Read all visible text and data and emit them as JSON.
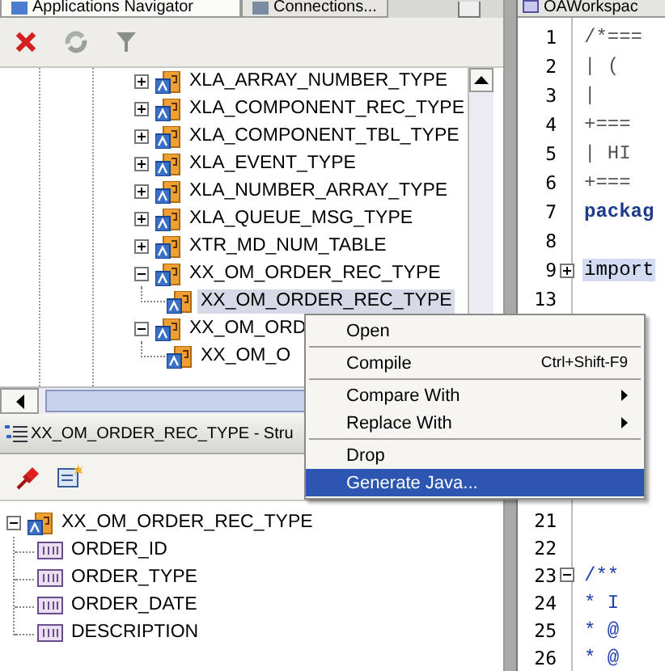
{
  "navigator": {
    "tabs": [
      {
        "label": "Applications Navigator",
        "selected": true
      },
      {
        "label": "Connections...",
        "selected": false
      }
    ],
    "tree": [
      {
        "label": "XLA_ARRAY_NUMBER_TYPE",
        "expanded": false,
        "selected": false
      },
      {
        "label": "XLA_COMPONENT_REC_TYPE",
        "expanded": false,
        "selected": false
      },
      {
        "label": "XLA_COMPONENT_TBL_TYPE",
        "expanded": false,
        "selected": false
      },
      {
        "label": "XLA_EVENT_TYPE",
        "expanded": false,
        "selected": false
      },
      {
        "label": "XLA_NUMBER_ARRAY_TYPE",
        "expanded": false,
        "selected": false
      },
      {
        "label": "XLA_QUEUE_MSG_TYPE",
        "expanded": false,
        "selected": false
      },
      {
        "label": "XTR_MD_NUM_TABLE",
        "expanded": false,
        "selected": false
      },
      {
        "label": "XX_OM_ORDER_REC_TYPE",
        "expanded": true,
        "selected": false,
        "children": [
          {
            "label": "XX_OM_ORDER_REC_TYPE",
            "selected": true
          }
        ]
      },
      {
        "label": "XX_OM_ORD",
        "expanded": true,
        "selected": false,
        "children": [
          {
            "label": "XX_OM_O",
            "selected": false
          }
        ]
      }
    ]
  },
  "structure": {
    "title": "XX_OM_ORDER_REC_TYPE - Stru",
    "tree": [
      {
        "label": "XX_OM_ORDER_REC_TYPE",
        "expanded": true,
        "children": [
          {
            "label": "ORDER_ID"
          },
          {
            "label": "ORDER_TYPE"
          },
          {
            "label": "ORDER_DATE"
          },
          {
            "label": "DESCRIPTION"
          }
        ]
      }
    ]
  },
  "editor": {
    "tab": "OAWorkspac",
    "lines_top": [
      {
        "number": "1",
        "code": "/*===",
        "kind": "comment",
        "highlighted": false
      },
      {
        "number": "2",
        "code": "|   (",
        "kind": "comment",
        "highlighted": false
      },
      {
        "number": "3",
        "code": "|",
        "kind": "comment",
        "highlighted": false
      },
      {
        "number": "4",
        "code": "+===",
        "kind": "comment",
        "highlighted": false
      },
      {
        "number": "5",
        "code": "|  HI",
        "kind": "comment",
        "highlighted": false
      },
      {
        "number": "6",
        "code": "+===",
        "kind": "comment",
        "highlighted": false
      },
      {
        "number": "7",
        "code": "packag",
        "kind": "keyword",
        "highlighted": false
      },
      {
        "number": "8",
        "kind": "plain",
        "highlighted": false
      },
      {
        "number": "9",
        "code": "import",
        "kind": "plain",
        "highlighted": true,
        "folded": true
      },
      {
        "number": "13",
        "kind": "plain",
        "highlighted": false
      }
    ],
    "lines_bottom": [
      {
        "number": "21",
        "kind": "plain",
        "highlighted": false
      },
      {
        "number": "22",
        "kind": "plain",
        "highlighted": false
      },
      {
        "number": "23",
        "code": "/**",
        "kind": "doc",
        "highlighted": false,
        "folded": false
      },
      {
        "number": "24",
        "code": "* I",
        "kind": "doc",
        "highlighted": false
      },
      {
        "number": "25",
        "code": "* @",
        "kind": "doc",
        "highlighted": false
      },
      {
        "number": "26",
        "code": "* @",
        "kind": "doc",
        "highlighted": false
      }
    ]
  },
  "context_menu": {
    "items": [
      {
        "label": "Open",
        "selected": false,
        "separator_after": true
      },
      {
        "label": "Compile",
        "shortcut": "Ctrl+Shift-F9",
        "selected": false,
        "separator_after": true
      },
      {
        "label": "Compare With",
        "submenu": true,
        "selected": false,
        "separator_after": false
      },
      {
        "label": "Replace With",
        "submenu": true,
        "selected": false,
        "separator_after": true
      },
      {
        "label": "Drop",
        "selected": false,
        "separator_after": false
      },
      {
        "label": "Generate Java...",
        "selected": true,
        "separator_after": false
      }
    ]
  }
}
